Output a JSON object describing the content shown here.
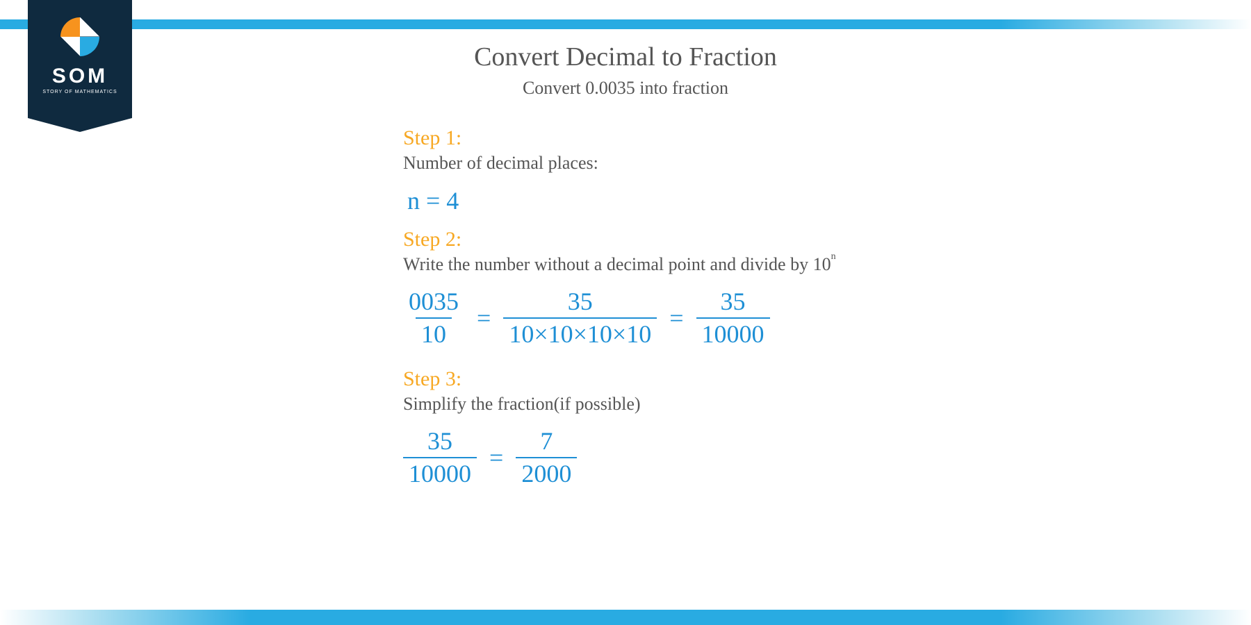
{
  "logo": {
    "text": "SOM",
    "subtitle": "STORY OF MATHEMATICS"
  },
  "title": "Convert Decimal to Fraction",
  "subtitle": "Convert 0.0035 into fraction",
  "step1": {
    "label": "Step 1:",
    "desc": "Number of decimal places:",
    "math": "n = 4"
  },
  "step2": {
    "label": "Step 2:",
    "desc_pre": "Write the number without a decimal point and divide by 10",
    "desc_sup": "n",
    "f1_num": "0035",
    "f1_den": "10",
    "f2_num": "35",
    "f2_den": "10×10×10×10",
    "f3_num": "35",
    "f3_den": "10000",
    "eq": "="
  },
  "step3": {
    "label": "Step 3:",
    "desc": "Simplify the fraction(if possible)",
    "f1_num": "35",
    "f1_den": "10000",
    "f2_num": "7",
    "f2_den": "2000",
    "eq": "="
  }
}
